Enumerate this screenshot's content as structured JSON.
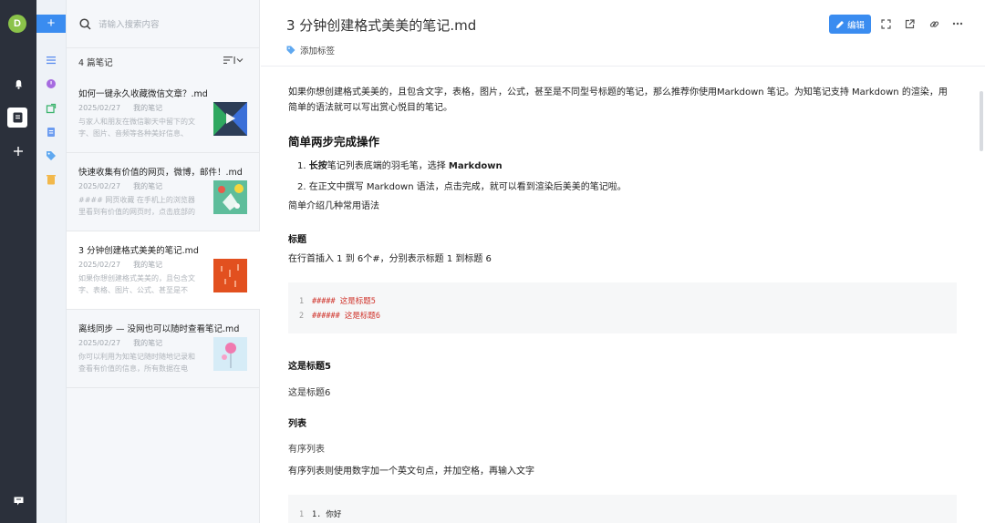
{
  "rail": {
    "avatar_letter": "D"
  },
  "folders": {
    "new_label": "+"
  },
  "notelist": {
    "search_placeholder": "请输入搜索内容",
    "count_label": "4 篇笔记",
    "notes": [
      {
        "title": "如何一键永久收藏微信文章？.md",
        "date": "2025/02/27",
        "folder": "我的笔记",
        "snippet": "与家人和朋友在微信聊天中留下的文字、图片、音频等各种美好信息、需..."
      },
      {
        "title": "快速收集有价值的网页，微博，邮件！.md",
        "date": "2025/02/27",
        "folder": "我的笔记",
        "snippet": "#### 网页收藏 在手机上的浏览器里看到有价值的网页时，点击底部的 **..."
      },
      {
        "title": "3 分钟创建格式美美的笔记.md",
        "date": "2025/02/27",
        "folder": "我的笔记",
        "snippet": "如果你想创建格式美美的，且包含文字、表格、图片、公式、甚至是不同..."
      },
      {
        "title": "离线同步 — 没网也可以随时查看笔记.md",
        "date": "2025/02/27",
        "folder": "我的笔记",
        "snippet": "你可以利用为知笔记随时随地记录和查看有价值的信息，所有数据在电脑、..."
      }
    ]
  },
  "editor": {
    "title": "3 分钟创建格式美美的笔记.md",
    "edit_label": "编辑",
    "add_tag_label": "添加标签",
    "intro": "如果你想创建格式美美的，且包含文字，表格，图片，公式，甚至是不同型号标题的笔记，那么推荐你使用Markdown 笔记。为知笔记支持 Markdown 的渲染，用简单的语法就可以写出赏心悦目的笔记。",
    "h_steps": "简单两步完成操作",
    "step1_bold": "长按",
    "step1_rest": "笔记列表底端的羽毛笔，选择 ",
    "step1_bold2": "Markdown",
    "step2": "在正文中撰写 Markdown 语法，点击完成，就可以看到渲染后美美的笔记啦。",
    "intro2": "简单介绍几种常用语法",
    "h_heading": "标题",
    "heading_desc": "在行首插入 1 到 6个#，分别表示标题 1 到标题 6",
    "code1": [
      {
        "n": "1",
        "text": "##### 这是标题5"
      },
      {
        "n": "2",
        "text": "###### 这是标题6"
      }
    ],
    "rendered_h5": "这是标题5",
    "rendered_h6": "这是标题6",
    "h_list": "列表",
    "ordered_list": "有序列表",
    "ordered_desc": "有序列表则使用数字加一个英文句点，并加空格，再输入文字",
    "code2": [
      {
        "n": "1",
        "text": "1. 你好"
      }
    ]
  }
}
